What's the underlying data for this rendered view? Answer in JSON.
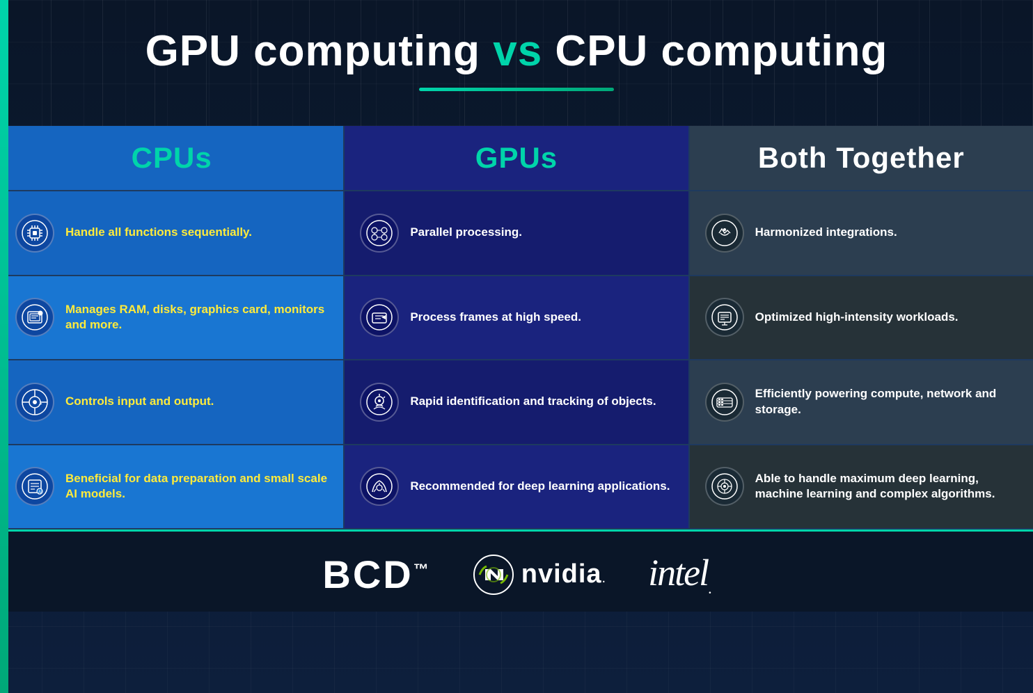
{
  "page": {
    "title": "GPU computing vs CPU computing",
    "title_parts": {
      "before_vs": "GPU computing ",
      "vs": "vs",
      "after_vs": " CPU computing"
    },
    "accent_color": "#00d4aa",
    "bg_color": "#0a1628"
  },
  "columns": [
    {
      "id": "cpus",
      "label": "CPUs",
      "header_color": "#1565c0",
      "text_color": "#00d4aa",
      "items": [
        {
          "icon": "🔵",
          "text": "Handle all functions sequentially."
        },
        {
          "icon": "🔵",
          "text": "Manages RAM, disks, graphics card, monitors and more."
        },
        {
          "icon": "🔵",
          "text": "Controls input and output."
        },
        {
          "icon": "🔵",
          "text": "Beneficial for data preparation and small scale AI models."
        }
      ]
    },
    {
      "id": "gpus",
      "label": "GPUs",
      "header_color": "#1a237e",
      "text_color": "#ffffff",
      "items": [
        {
          "icon": "🟣",
          "text": "Parallel processing."
        },
        {
          "icon": "🟣",
          "text": "Process frames at high speed."
        },
        {
          "icon": "🟣",
          "text": "Rapid identification and tracking of objects."
        },
        {
          "icon": "🟣",
          "text": "Recommended for deep learning applications."
        }
      ]
    },
    {
      "id": "both",
      "label": "Both Together",
      "header_color": "#2c3e50",
      "text_color": "#ffffff",
      "items": [
        {
          "icon": "⚪",
          "text": "Harmonized integrations."
        },
        {
          "icon": "⚪",
          "text": "Optimized high-intensity workloads."
        },
        {
          "icon": "⚪",
          "text": "Efficiently powering compute, network and storage."
        },
        {
          "icon": "⚪",
          "text": "Able to handle maximum deep learning, machine learning and complex algorithms."
        }
      ]
    }
  ],
  "footer": {
    "brands": [
      {
        "id": "bcd",
        "label": "BCD™"
      },
      {
        "id": "nvidia",
        "label": "NVIDIA."
      },
      {
        "id": "intel",
        "label": "intel."
      }
    ]
  }
}
